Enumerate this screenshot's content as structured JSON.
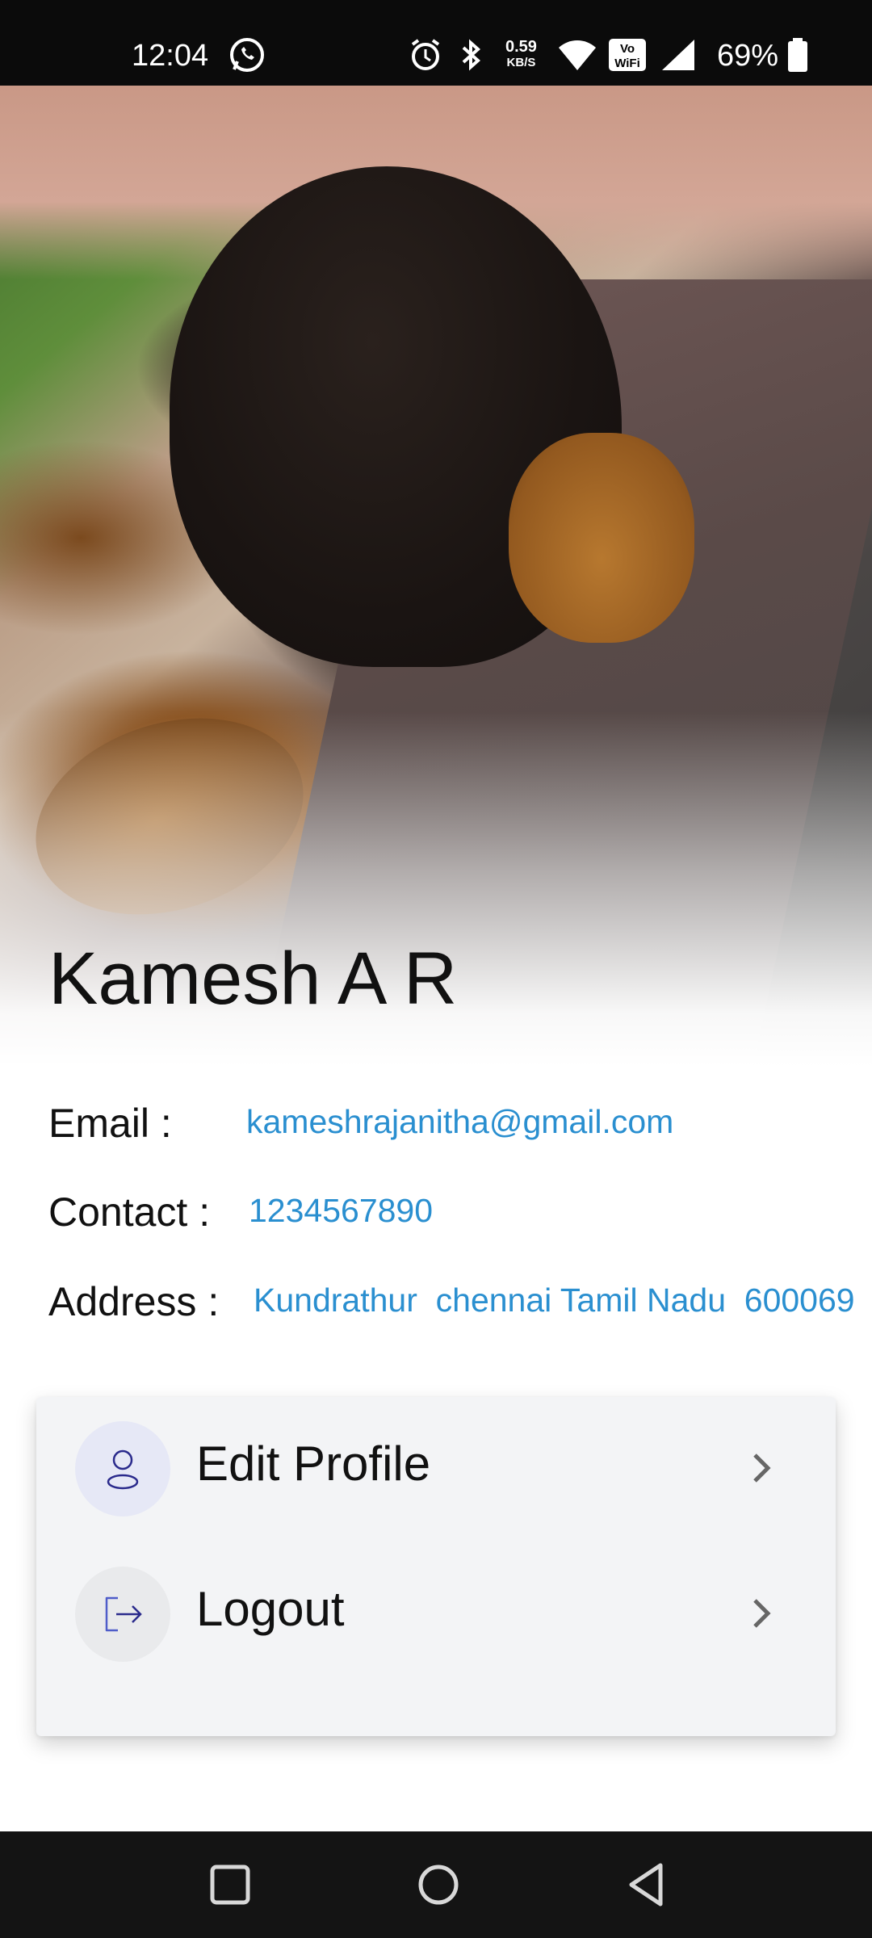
{
  "status_bar": {
    "time": "12:04",
    "net_speed": "0.59",
    "net_speed_unit": "KB/S",
    "battery": "69%",
    "volte_badge_top": "Vo",
    "volte_badge_bottom": "WiFi"
  },
  "profile": {
    "name": "Kamesh A R",
    "email_label": "Email :",
    "email": "kameshrajanitha@gmail.com",
    "contact_label": "Contact :",
    "contact": "1234567890",
    "address_label": "Address :",
    "address": "Kundrathur  chennai Tamil Nadu  600069"
  },
  "menu": {
    "items": [
      {
        "label": "Edit Profile",
        "icon": "user-icon"
      },
      {
        "label": "Logout",
        "icon": "logout-icon"
      }
    ]
  },
  "colors": {
    "accent_link": "#2a8fd0",
    "icon_indigo": "#2a2a8c",
    "card_bg": "#f3f4f6"
  }
}
